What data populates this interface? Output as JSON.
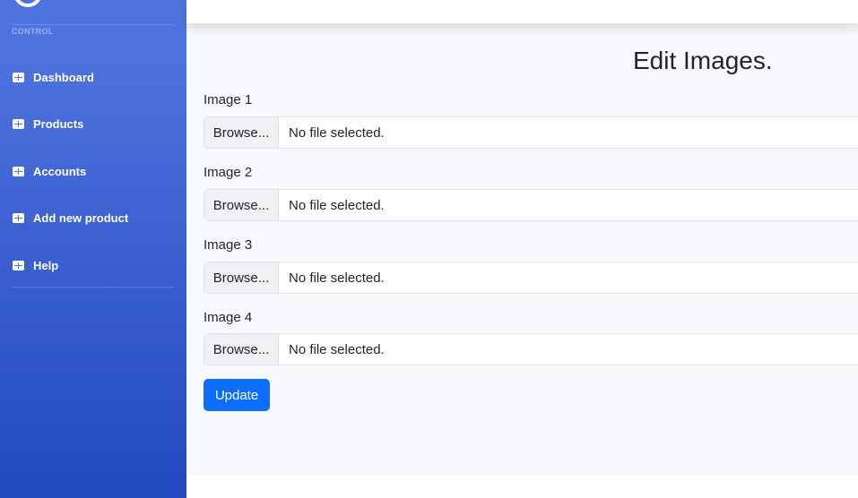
{
  "sidebar": {
    "heading": "CONTROL",
    "items": [
      {
        "label": "Dashboard",
        "icon": "table-icon"
      },
      {
        "label": "Products",
        "icon": "table-icon"
      },
      {
        "label": "Accounts",
        "icon": "table-icon"
      },
      {
        "label": "Add new product",
        "icon": "table-icon"
      },
      {
        "label": "Help",
        "icon": "table-icon"
      }
    ]
  },
  "main": {
    "title": "Edit Images.",
    "fields": [
      {
        "label": "Image 1",
        "browse_label": "Browse...",
        "status": "No file selected."
      },
      {
        "label": "Image 2",
        "browse_label": "Browse...",
        "status": "No file selected."
      },
      {
        "label": "Image 3",
        "browse_label": "Browse...",
        "status": "No file selected."
      },
      {
        "label": "Image 4",
        "browse_label": "Browse...",
        "status": "No file selected."
      }
    ],
    "submit_label": "Update"
  },
  "colors": {
    "sidebar_top": "#4e73df",
    "sidebar_bottom": "#224abe",
    "primary_button": "#0d6efd",
    "content_bg": "#f8f9fc"
  }
}
